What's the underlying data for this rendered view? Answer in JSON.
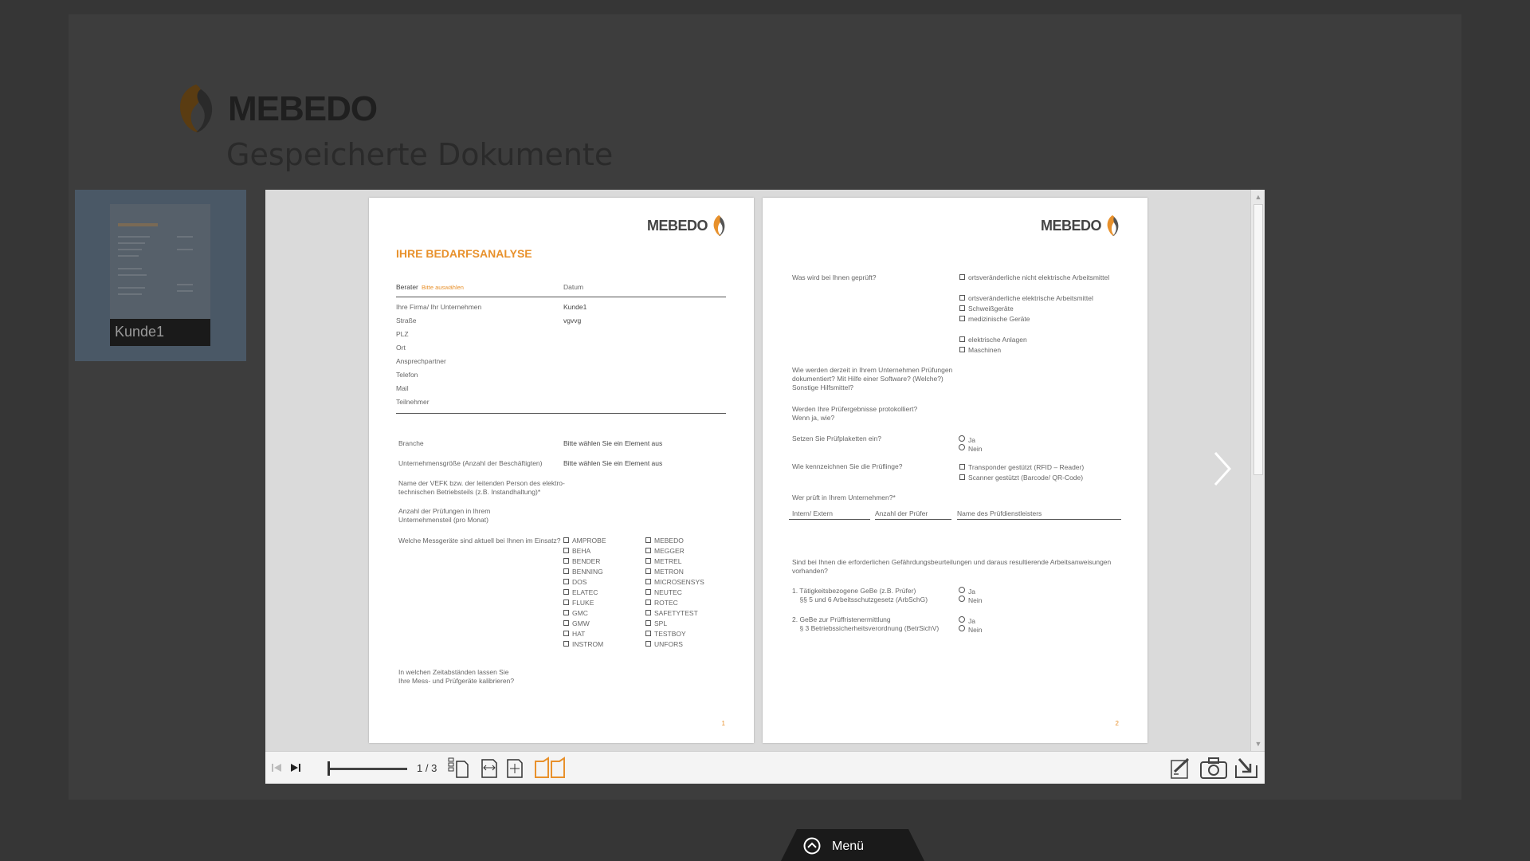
{
  "app": {
    "brand": "MEBEDO",
    "page_title": "Gespeicherte Dokumente"
  },
  "documents": [
    {
      "label": "Kunde1"
    }
  ],
  "viewer": {
    "page_indicator": "1 / 3",
    "page1": {
      "brand": "MEBEDO",
      "heading": "IHRE BEDARFSANALYSE",
      "berater_label": "Berater",
      "berater_value": "Bitte auswählen",
      "datum_label": "Datum",
      "fields": [
        {
          "label": "Ihre Firma/ Ihr Unternehmen",
          "value": "Kunde1"
        },
        {
          "label": "Straße",
          "value": "vgvvg"
        },
        {
          "label": "PLZ",
          "value": ""
        },
        {
          "label": "Ort",
          "value": ""
        },
        {
          "label": "Ansprechpartner",
          "value": ""
        },
        {
          "label": "Telefon",
          "value": ""
        },
        {
          "label": "Mail",
          "value": ""
        },
        {
          "label": "Teilnehmer",
          "value": ""
        }
      ],
      "branche_label": "Branche",
      "branche_value": "Bitte wählen Sie ein Element aus",
      "groesse_label": "Unternehmensgröße (Anzahl der Beschäftigten)",
      "groesse_value": "Bitte wählen Sie ein Element aus",
      "vefk_label": "Name der VEFK bzw. der leitenden Person des elektro-\ntechnischen Betriebsteils (z.B. Instandhaltung)*",
      "anzahl_label": "Anzahl der Prüfungen in Ihrem\nUnternehmensteil (pro Monat)",
      "messgeraete_label": "Welche Messgeräte sind aktuell bei Ihnen im Einsatz?",
      "devices_col1": [
        "AMPROBE",
        "BEHA",
        "BENDER",
        "BENNING",
        "DOS",
        "ELATEC",
        "FLUKE",
        "GMC",
        "GMW",
        "HAT",
        "INSTROM"
      ],
      "devices_col2": [
        "MEBEDO",
        "MEGGER",
        "METREL",
        "METRON",
        "MICROSENSYS",
        "NEUTEC",
        "ROTEC",
        "SAFETYTEST",
        "SPL",
        "TESTBOY",
        "UNFORS"
      ],
      "kalibrier_label": "In welchen Zeitabständen lassen Sie\nIhre Mess- und Prüfgeräte kalibrieren?",
      "page_number": "1"
    },
    "page2": {
      "brand": "MEBEDO",
      "q_geprueft": "Was wird bei Ihnen geprüft?",
      "geprueft_opts": [
        "ortsveränderliche nicht elektrische Arbeitsmittel",
        "ortsveränderliche elektrische Arbeitsmittel",
        "Schweißgeräte",
        "medizinische Geräte",
        "elektrische Anlagen",
        "Maschinen"
      ],
      "q_dokumentiert": "Wie werden derzeit in Ihrem Unternehmen Prüfungen\ndokumentiert? Mit Hilfe einer Software? (Welche?)\nSonstige Hilfsmittel?",
      "q_protokolliert": "Werden Ihre Prüfergebnisse protokolliert?\nWenn ja, wie?",
      "q_plaketten": "Setzen Sie Prüfplaketten ein?",
      "ja": "Ja",
      "nein": "Nein",
      "q_kennzeichnen": "Wie kennzeichnen Sie die Prüflinge?",
      "kennzeichnen_opts": [
        "Transponder gestützt (RFID – Reader)",
        "Scanner gestützt (Barcode/ QR-Code)"
      ],
      "q_wer": "Wer prüft in Ihrem Unternehmen?*",
      "col_intern": "Intern/ Extern",
      "col_anzahl": "Anzahl der Prüfer",
      "col_name": "Name des Prüfdienstleisters",
      "q_gefaehrdung": "Sind bei Ihnen die erforderlichen Gefährdungsbeurteilungen und daraus resultierende Arbeitsanweisungen\nvorhanden?",
      "item1": "1. Tätigkeitsbezogene GeBe (z.B. Prüfer)\n    §§ 5 und 6 Arbeitsschutzgesetz (ArbSchG)",
      "item2": "2. GeBe zur Prüffristenermittlung\n    § 3 Betriebssicherheitsverordnung (BetrSichV)",
      "page_number": "2"
    }
  },
  "menu": {
    "label": "Menü"
  },
  "icons": {
    "first": "first-page-icon",
    "last": "last-page-icon",
    "single": "single-page-icon",
    "fit_width": "fit-width-icon",
    "fit_page": "fit-page-icon",
    "double": "double-page-icon",
    "annotate": "annotate-icon",
    "snapshot": "camera-icon",
    "export": "export-icon",
    "next": "chevron-right-icon",
    "menu": "chevron-up-circle-icon"
  },
  "colors": {
    "accent": "#e8912c",
    "background": "#363636",
    "thumb_card": "#4a5866"
  }
}
